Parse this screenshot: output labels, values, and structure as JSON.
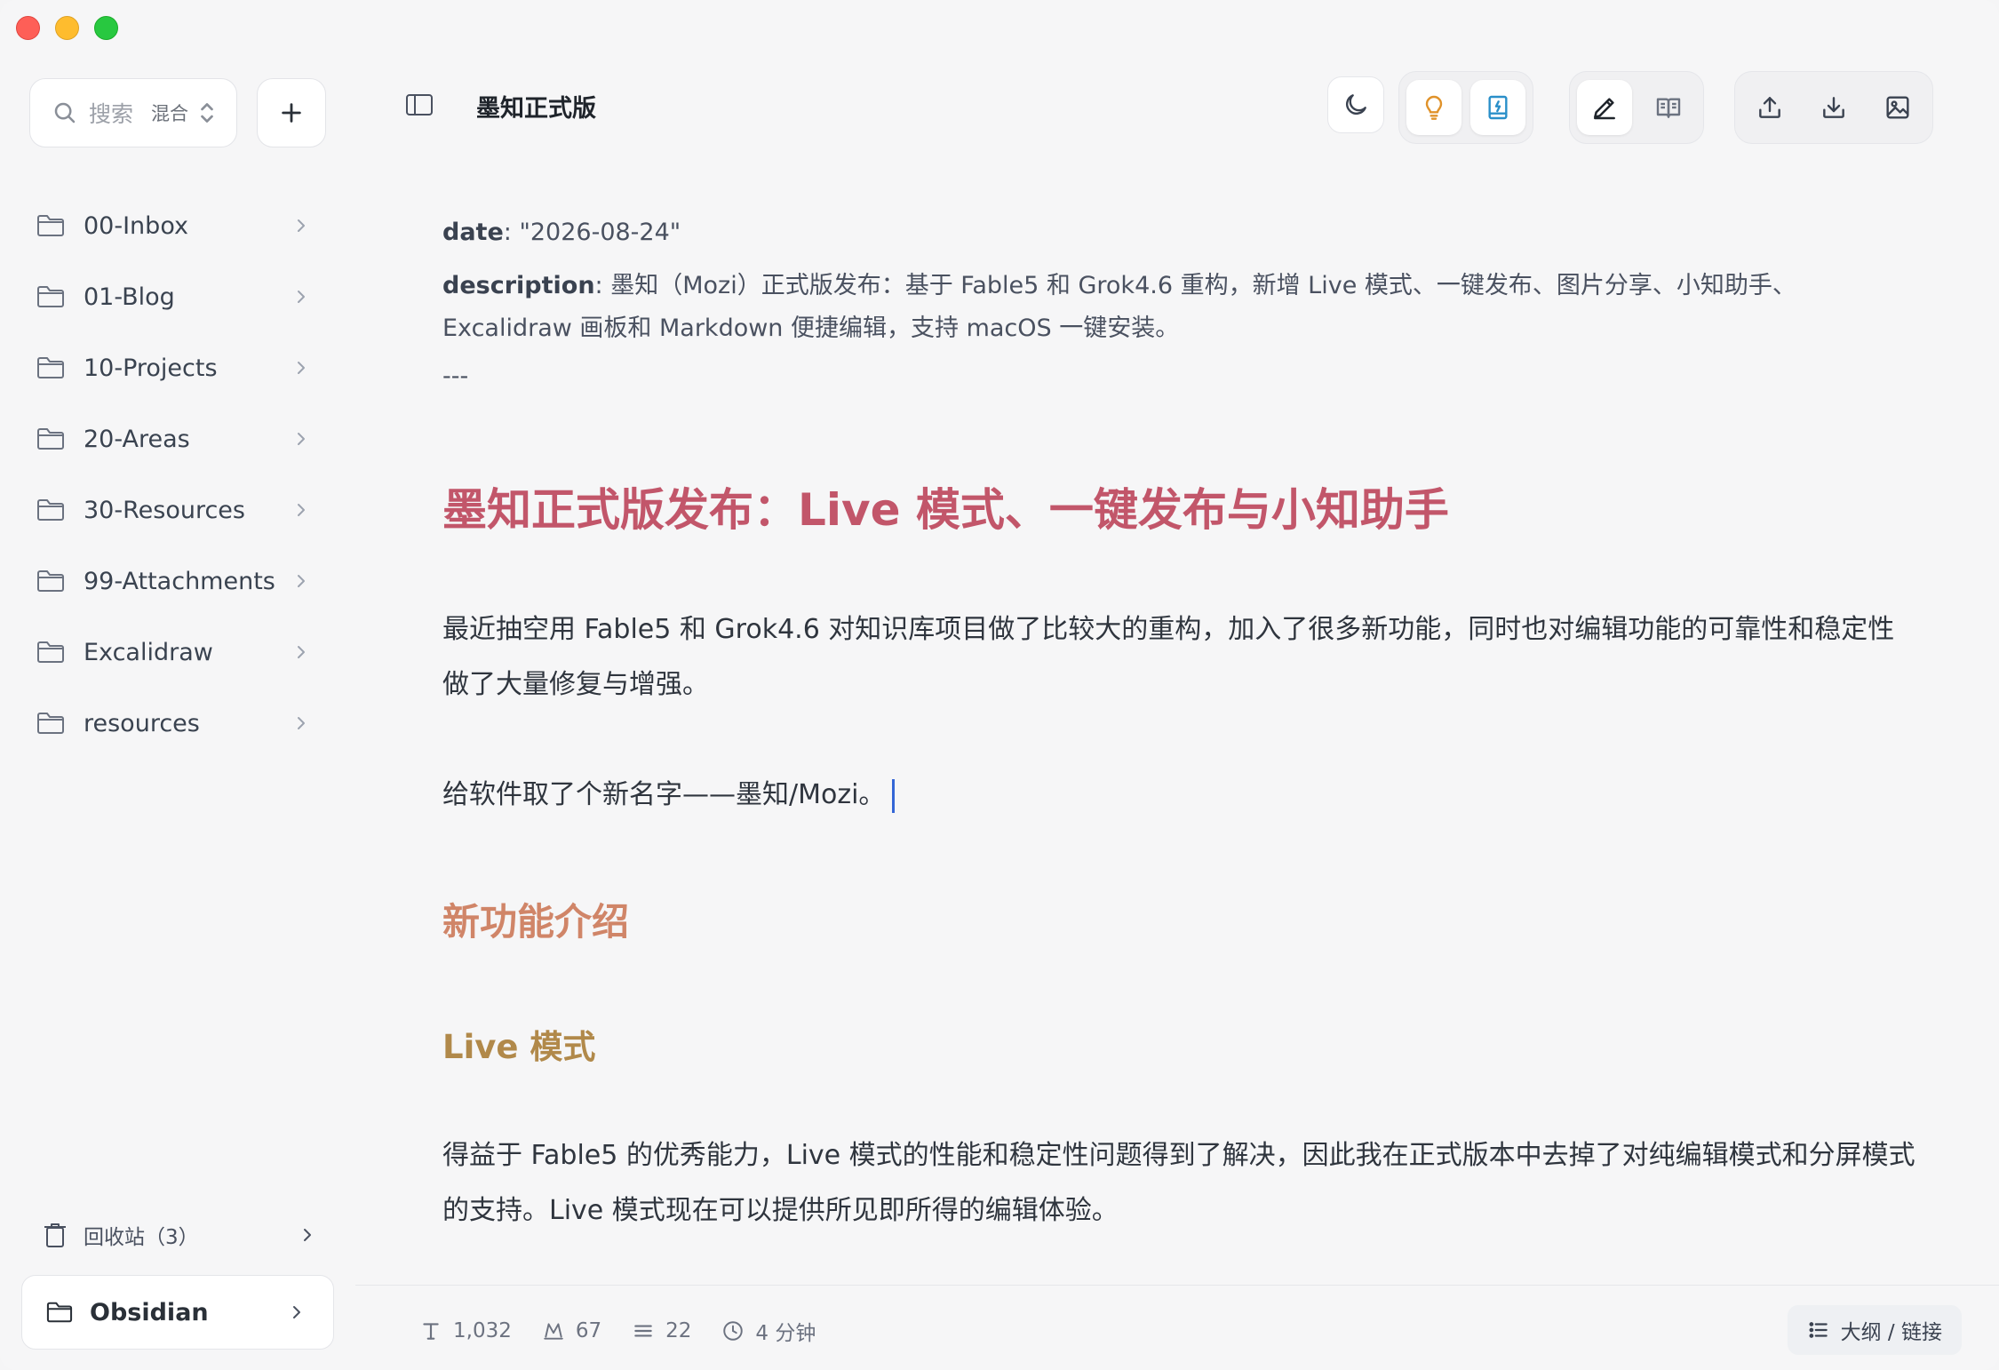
{
  "window": {
    "controls": [
      "close",
      "minimize",
      "maximize"
    ]
  },
  "sidebar": {
    "search": {
      "placeholder": "搜索",
      "mode": "混合"
    },
    "folders": [
      {
        "label": "00-Inbox"
      },
      {
        "label": "01-Blog"
      },
      {
        "label": "10-Projects"
      },
      {
        "label": "20-Areas"
      },
      {
        "label": "30-Resources"
      },
      {
        "label": "99-Attachments"
      },
      {
        "label": "Excalidraw"
      },
      {
        "label": "resources"
      }
    ],
    "trash": {
      "label": "回收站（3）"
    },
    "vault": {
      "label": "Obsidian"
    }
  },
  "header": {
    "title": "墨知正式版",
    "toolbar_icons": [
      "moon-icon",
      "lightbulb-icon",
      "ai-book-icon",
      "pen-icon",
      "reader-icon",
      "upload-icon",
      "download-icon",
      "image-icon"
    ]
  },
  "document": {
    "frontmatter": {
      "date_key": "date",
      "date_value": ": \"2026-08-24\"",
      "desc_key": "description",
      "desc_value": ": 墨知（Mozi）正式版发布：基于 Fable5 和 Grok4.6 重构，新增 Live 模式、一键发布、图片分享、小知助手、Excalidraw 画板和 Markdown 便捷编辑，支持 macOS 一键安装。",
      "separator": "---"
    },
    "h1": "墨知正式版发布：Live 模式、一键发布与小知助手",
    "p1": "最近抽空用 Fable5 和 Grok4.6 对知识库项目做了比较大的重构，加入了很多新功能，同时也对编辑功能的可靠性和稳定性做了大量修复与增强。",
    "p2": "给软件取了个新名字——墨知/Mozi。",
    "h2": "新功能介绍",
    "h3": "Live 模式",
    "p3": "得益于 Fable5 的优秀能力，Live 模式的性能和稳定性问题得到了解决，因此我在正式版本中去掉了对纯编辑模式和分屏模式的支持。Live 模式现在可以提供所见即所得的编辑体验。"
  },
  "status": {
    "chars": "1,032",
    "words": "67",
    "lines": "22",
    "reading_time": "4 分钟",
    "outline_button": "大纲 / 链接"
  },
  "colors": {
    "h1": "#c2566a",
    "h2": "#d08568",
    "h3": "#b1894a",
    "lightbulb": "#e0922a",
    "ai_book": "#2a8fc9"
  }
}
